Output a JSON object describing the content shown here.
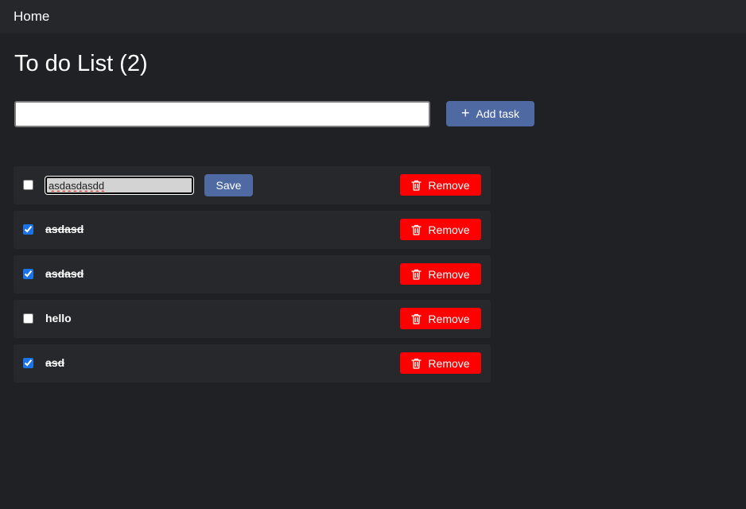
{
  "nav": {
    "home_label": "Home"
  },
  "page": {
    "title": "To do List (2)"
  },
  "new_task": {
    "value": "",
    "placeholder": "",
    "add_label": "Add task",
    "add_icon": "plus-icon"
  },
  "tasks": [
    {
      "label": "asdasdasdd",
      "checked": false,
      "editing": true,
      "edit_value": "asdasdasdd",
      "save_label": "Save",
      "remove_label": "Remove",
      "remove_icon": "trash-icon"
    },
    {
      "label": "asdasd",
      "checked": true,
      "editing": false,
      "remove_label": "Remove",
      "remove_icon": "trash-icon"
    },
    {
      "label": "asdasd",
      "checked": true,
      "editing": false,
      "remove_label": "Remove",
      "remove_icon": "trash-icon"
    },
    {
      "label": "hello",
      "checked": false,
      "editing": false,
      "remove_label": "Remove",
      "remove_icon": "trash-icon"
    },
    {
      "label": "asd",
      "checked": true,
      "editing": false,
      "remove_label": "Remove",
      "remove_icon": "trash-icon"
    }
  ],
  "colors": {
    "background": "#202124",
    "topbar": "#26272a",
    "row": "#27282b",
    "primary_button": "#4f6aa3",
    "danger_button": "#ff0000"
  }
}
